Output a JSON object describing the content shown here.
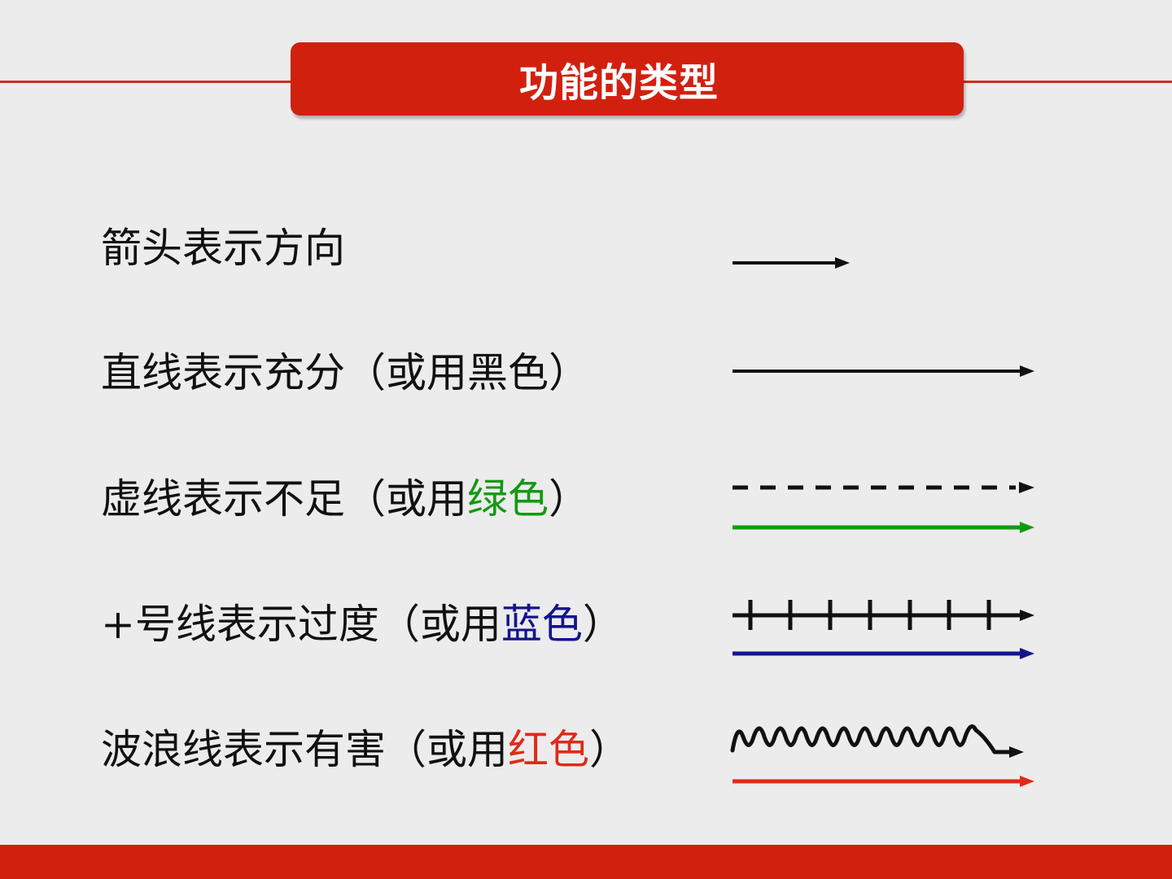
{
  "title": "功能的类型",
  "rows": [
    {
      "pre": "箭头表示方向",
      "colored": "",
      "post": "",
      "color": "#111111"
    },
    {
      "pre": "直线表示充分（或用黑色）",
      "colored": "",
      "post": "",
      "color": "#111111"
    },
    {
      "pre": "虚线表示不足（或用",
      "colored": "绿色",
      "post": "）",
      "color": "#119a11"
    },
    {
      "pre": "+号线表示过度（或用",
      "colored": "蓝色",
      "post": "）",
      "color": "#14148c"
    },
    {
      "pre": "波浪线表示有害（或用",
      "colored": "红色",
      "post": "）",
      "color": "#e02a1a"
    }
  ],
  "colors": {
    "accent_red": "#d2200f",
    "black": "#111111",
    "green": "#119a11",
    "blue": "#14148c",
    "red": "#e02a1a"
  }
}
